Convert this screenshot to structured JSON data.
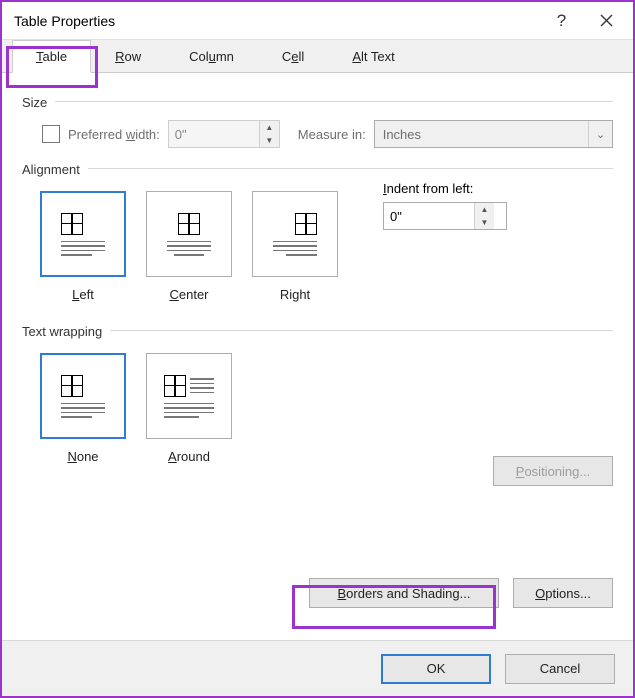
{
  "window": {
    "title": "Table Properties"
  },
  "tabs": {
    "table": "Table",
    "row": "Row",
    "column": "Column",
    "cell": "Cell",
    "alttext": "Alt Text"
  },
  "size": {
    "group_label": "Size",
    "preferred_width_label": "Preferred width:",
    "preferred_width_value": "0\"",
    "measure_in_label": "Measure in:",
    "measure_in_value": "Inches"
  },
  "alignment": {
    "group_label": "Alignment",
    "left": "Left",
    "center": "Center",
    "right": "Right",
    "indent_label": "Indent from left:",
    "indent_value": "0\""
  },
  "wrapping": {
    "group_label": "Text wrapping",
    "none": "None",
    "around": "Around"
  },
  "buttons": {
    "positioning": "Positioning...",
    "borders": "Borders and Shading...",
    "options": "Options...",
    "ok": "OK",
    "cancel": "Cancel"
  }
}
